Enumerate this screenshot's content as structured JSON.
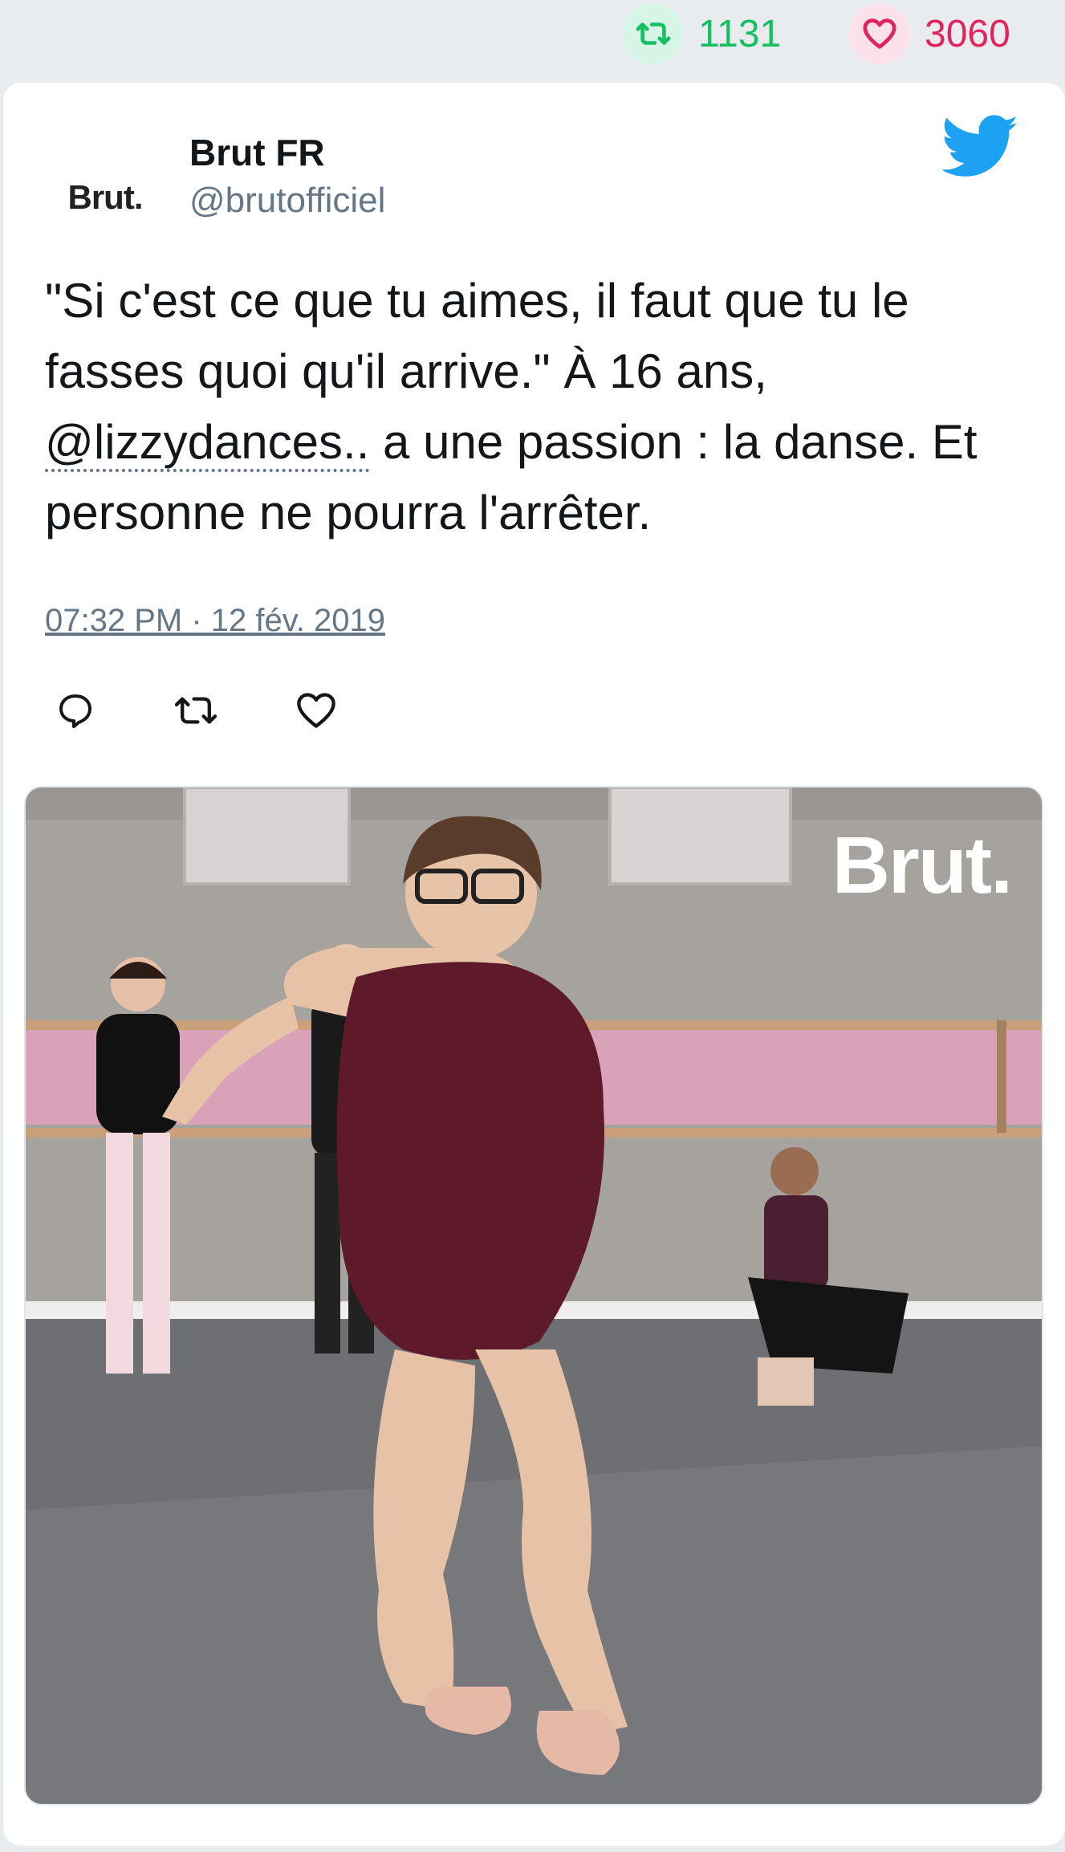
{
  "stats": {
    "retweets": "1131",
    "likes": "3060",
    "retweet_color": "#17bf63",
    "like_color": "#e0245e"
  },
  "author": {
    "avatar_text": "Brut.",
    "name": "Brut FR",
    "handle": "@brutofficiel"
  },
  "tweet": {
    "text_before": "\"Si c'est ce que tu aimes, il faut que tu le fasses quoi qu'il arrive.\" À 16 ans, ",
    "mention": "@lizzydances..",
    "text_after": " a une passion : la danse. Et personne ne pourra l'arrêter.",
    "timestamp": "07:32 PM · 12 fév. 2019"
  },
  "actions": {
    "reply_icon": "reply-icon",
    "retweet_icon": "retweet-icon",
    "like_icon": "heart-icon"
  },
  "media": {
    "watermark": "Brut."
  },
  "colors": {
    "twitter_blue": "#1da1f2",
    "secondary_text": "#657786"
  }
}
